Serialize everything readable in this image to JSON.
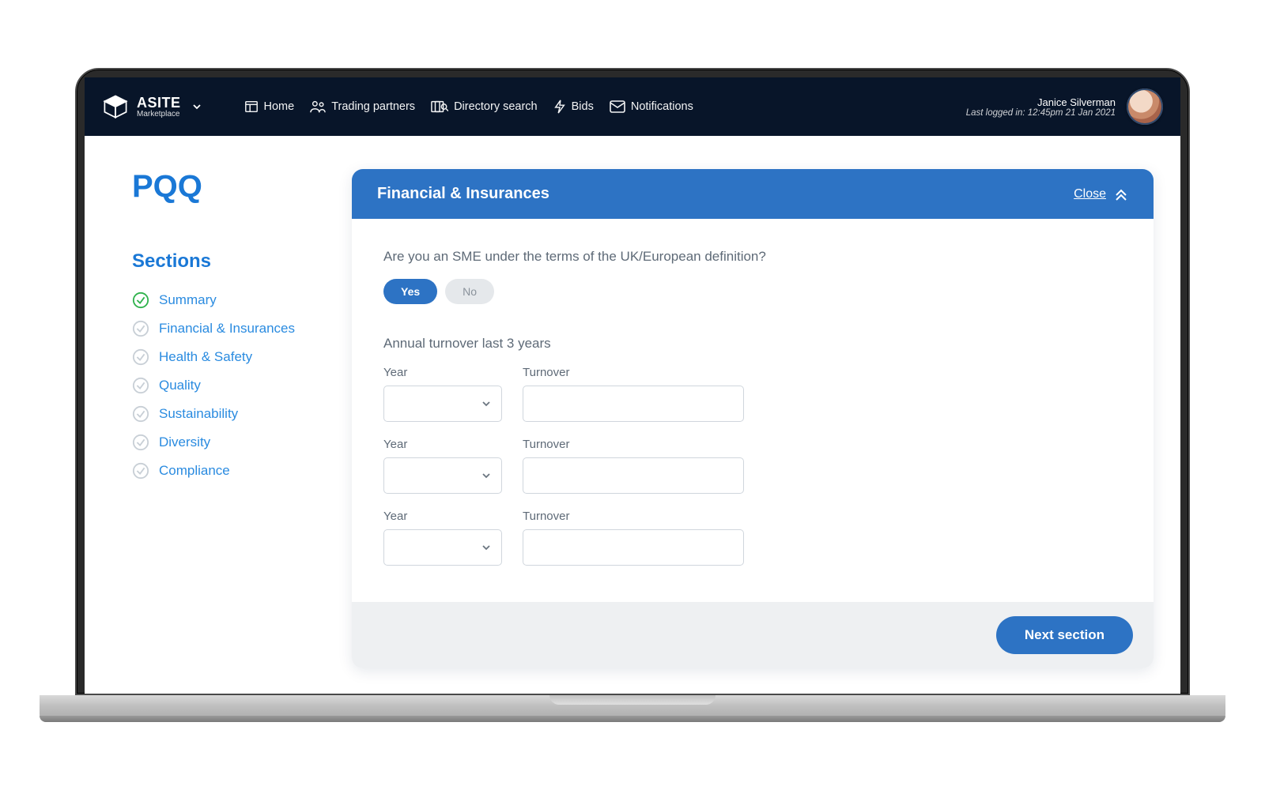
{
  "brand": {
    "name": "ASITE",
    "sub": "Marketplace"
  },
  "nav": {
    "home": "Home",
    "trading": "Trading partners",
    "directory": "Directory search",
    "bids": "Bids",
    "notifications": "Notifications"
  },
  "user": {
    "name": "Janice Silverman",
    "last_login": "Last logged in: 12:45pm 21 Jan 2021"
  },
  "page": {
    "title": "PQQ",
    "sections_heading": "Sections",
    "sections": [
      {
        "label": "Summary",
        "done": true
      },
      {
        "label": "Financial & Insurances",
        "done": false
      },
      {
        "label": "Health & Safety",
        "done": false
      },
      {
        "label": "Quality",
        "done": false
      },
      {
        "label": "Sustainability",
        "done": false
      },
      {
        "label": "Diversity",
        "done": false
      },
      {
        "label": "Compliance",
        "done": false
      }
    ]
  },
  "panel": {
    "title": "Financial & Insurances",
    "close": "Close",
    "question": "Are you an SME under the terms of the UK/European definition?",
    "yes": "Yes",
    "no": "No",
    "turnover_heading": "Annual turnover last 3 years",
    "year_label": "Year",
    "turnover_label": "Turnover",
    "next": "Next section"
  }
}
